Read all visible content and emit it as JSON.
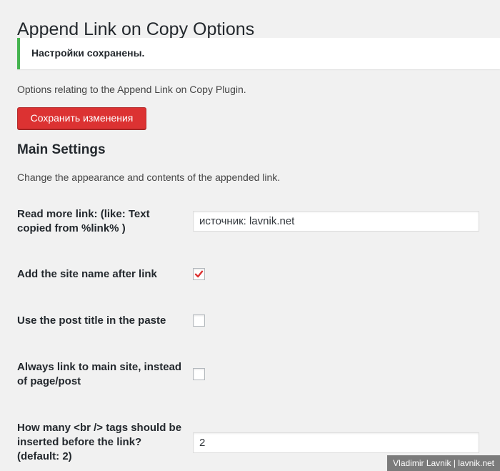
{
  "page": {
    "title": "Append Link on Copy Options",
    "notice": "Настройки сохранены.",
    "description": "Options relating to the Append Link on Copy Plugin.",
    "save_button": "Сохранить изменения"
  },
  "main_settings": {
    "title": "Main Settings",
    "description": "Change the appearance and contents of the appended link.",
    "read_more": {
      "label": "Read more link: (like: Text copied from %link% )",
      "value": "источник: lavnik.net"
    },
    "site_name": {
      "label": "Add the site name after link",
      "checked": true
    },
    "post_title": {
      "label": "Use the post title in the paste",
      "checked": false
    },
    "main_site": {
      "label": "Always link to main site, instead of page/post",
      "checked": false
    },
    "br_tags": {
      "label": "How many <br /> tags should be inserted before the link? (default: 2)",
      "value": "2"
    }
  },
  "watermark": "Vladimir Lavnik | lavnik.net",
  "colors": {
    "notice_border": "#46b450",
    "save_button_bg": "#dc3232",
    "checkmark": "#dc3232",
    "background": "#f1f1f1"
  },
  "icons": {
    "checkmark": "checkmark-icon"
  }
}
